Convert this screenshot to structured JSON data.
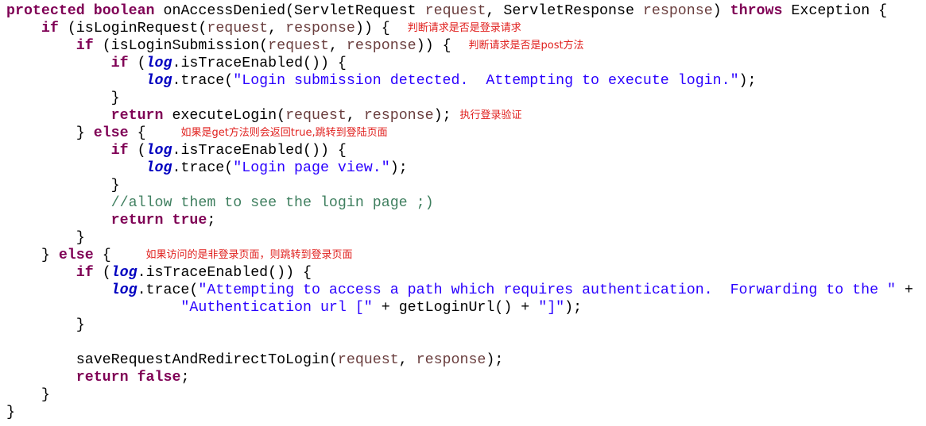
{
  "colors": {
    "keyword": "#7f0055",
    "parameter": "#6a3e3e",
    "field": "#0000c0",
    "string": "#2a00ff",
    "comment": "#3f7f5f",
    "annotation": "#e0201e",
    "plain": "#000000",
    "background": "#ffffff"
  },
  "lines": [
    [
      [
        "kw",
        "protected"
      ],
      [
        "p",
        " "
      ],
      [
        "kw",
        "boolean"
      ],
      [
        "p",
        " onAccessDenied(ServletRequest "
      ],
      [
        "param",
        "request"
      ],
      [
        "p",
        ", ServletResponse "
      ],
      [
        "param",
        "response"
      ],
      [
        "p",
        ") "
      ],
      [
        "kw",
        "throws"
      ],
      [
        "p",
        " Exception {"
      ]
    ],
    [
      [
        "p",
        "    "
      ],
      [
        "kw",
        "if"
      ],
      [
        "p",
        " (isLoginRequest("
      ],
      [
        "param",
        "request"
      ],
      [
        "p",
        ", "
      ],
      [
        "param",
        "response"
      ],
      [
        "p",
        ")) {  "
      ],
      [
        "note",
        "判断请求是否是登录请求"
      ]
    ],
    [
      [
        "p",
        "        "
      ],
      [
        "kw",
        "if"
      ],
      [
        "p",
        " (isLoginSubmission("
      ],
      [
        "param",
        "request"
      ],
      [
        "p",
        ", "
      ],
      [
        "param",
        "response"
      ],
      [
        "p",
        ")) {  "
      ],
      [
        "note",
        "判断请求是否是post方法"
      ]
    ],
    [
      [
        "p",
        "            "
      ],
      [
        "kw",
        "if"
      ],
      [
        "p",
        " ("
      ],
      [
        "field",
        "log"
      ],
      [
        "p",
        ".isTraceEnabled()) {"
      ]
    ],
    [
      [
        "p",
        "                "
      ],
      [
        "field",
        "log"
      ],
      [
        "p",
        ".trace("
      ],
      [
        "str",
        "\"Login submission detected.  Attempting to execute login.\""
      ],
      [
        "p",
        ");"
      ]
    ],
    [
      [
        "p",
        "            }"
      ]
    ],
    [
      [
        "p",
        "            "
      ],
      [
        "kw",
        "return"
      ],
      [
        "p",
        " executeLogin("
      ],
      [
        "param",
        "request"
      ],
      [
        "p",
        ", "
      ],
      [
        "param",
        "response"
      ],
      [
        "p",
        "); "
      ],
      [
        "note",
        "执行登录验证"
      ]
    ],
    [
      [
        "p",
        "        } "
      ],
      [
        "kw",
        "else"
      ],
      [
        "p",
        " {    "
      ],
      [
        "note",
        "如果是get方法则会返回true,跳转到登陆页面"
      ]
    ],
    [
      [
        "p",
        "            "
      ],
      [
        "kw",
        "if"
      ],
      [
        "p",
        " ("
      ],
      [
        "field",
        "log"
      ],
      [
        "p",
        ".isTraceEnabled()) {"
      ]
    ],
    [
      [
        "p",
        "                "
      ],
      [
        "field",
        "log"
      ],
      [
        "p",
        ".trace("
      ],
      [
        "str",
        "\"Login page view.\""
      ],
      [
        "p",
        ");"
      ]
    ],
    [
      [
        "p",
        "            }"
      ]
    ],
    [
      [
        "p",
        "            "
      ],
      [
        "cmt",
        "//allow them to see the login page ;)"
      ]
    ],
    [
      [
        "p",
        "            "
      ],
      [
        "kw",
        "return"
      ],
      [
        "p",
        " "
      ],
      [
        "kw",
        "true"
      ],
      [
        "p",
        ";"
      ]
    ],
    [
      [
        "p",
        "        }"
      ]
    ],
    [
      [
        "p",
        "    } "
      ],
      [
        "kw",
        "else"
      ],
      [
        "p",
        " {    "
      ],
      [
        "note",
        "如果访问的是非登录页面，则跳转到登录页面"
      ]
    ],
    [
      [
        "p",
        "        "
      ],
      [
        "kw",
        "if"
      ],
      [
        "p",
        " ("
      ],
      [
        "field",
        "log"
      ],
      [
        "p",
        ".isTraceEnabled()) {"
      ]
    ],
    [
      [
        "p",
        "            "
      ],
      [
        "field",
        "log"
      ],
      [
        "p",
        ".trace("
      ],
      [
        "str",
        "\"Attempting to access a path which requires authentication.  Forwarding to the \""
      ],
      [
        "p",
        " +"
      ]
    ],
    [
      [
        "p",
        "                    "
      ],
      [
        "str",
        "\"Authentication url [\""
      ],
      [
        "p",
        " + getLoginUrl() + "
      ],
      [
        "str",
        "\"]\""
      ],
      [
        "p",
        ");"
      ]
    ],
    [
      [
        "p",
        "        }"
      ]
    ],
    [
      [
        "p",
        ""
      ]
    ],
    [
      [
        "p",
        "        saveRequestAndRedirectToLogin("
      ],
      [
        "param",
        "request"
      ],
      [
        "p",
        ", "
      ],
      [
        "param",
        "response"
      ],
      [
        "p",
        ");"
      ]
    ],
    [
      [
        "p",
        "        "
      ],
      [
        "kw",
        "return"
      ],
      [
        "p",
        " "
      ],
      [
        "kw",
        "false"
      ],
      [
        "p",
        ";"
      ]
    ],
    [
      [
        "p",
        "    }"
      ]
    ],
    [
      [
        "p",
        "}"
      ]
    ]
  ]
}
